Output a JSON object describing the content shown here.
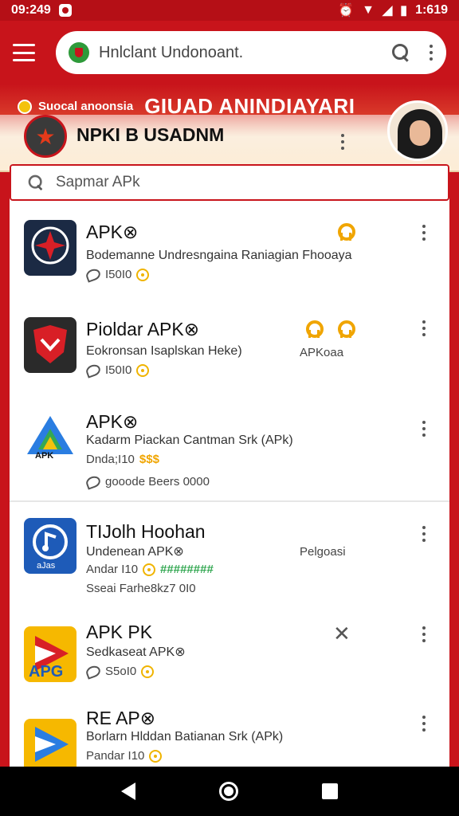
{
  "status_bar": {
    "time": "09:249",
    "clock": "1:619"
  },
  "app_bar": {
    "title": "Hnlclant Undonoant."
  },
  "hero": {
    "tagline_small": "Suocal anoonsia",
    "tagline_big": "GIUAD ANINDIAYARI",
    "subtitle": "NPKI B USADNM"
  },
  "search": {
    "placeholder": "Sapmar APk"
  },
  "apps": [
    {
      "name": "APK⊗",
      "desc": "Bodemanne Undresngaina Raniagian Fhooaya",
      "meta": "I50I0",
      "extra": ""
    },
    {
      "name": "Pioldar APK⊗",
      "desc": "Eokronsan Isaplskan Heke)",
      "meta": "I50I0",
      "extra": "APKoaa"
    },
    {
      "name": "APK⊗",
      "desc": "Kadarm Piackan Cantman Srk (APk)",
      "meta": "Dnda;I10",
      "extra": "gooode Beers 0000",
      "logo_caption": "APK"
    },
    {
      "name": "TIJolh Hoohan",
      "desc": "Undenean APK⊗",
      "meta": "Andar I10",
      "extra": "Sseai Farhe8kz7 0I0",
      "side": "Pelgoasi",
      "logo_caption": "aJas"
    },
    {
      "name": "APK PK",
      "desc": "Sedkaseat APK⊗",
      "meta": "S5oI0",
      "extra": "",
      "logo_caption": "APG"
    },
    {
      "name": "RE AP⊗",
      "desc": "Borlarn Hlddan Batianan Srk (APk)",
      "meta": "Pandar I10",
      "extra": ""
    }
  ],
  "colors": {
    "brand_red": "#c8141b",
    "accent_gold": "#f0a500"
  }
}
